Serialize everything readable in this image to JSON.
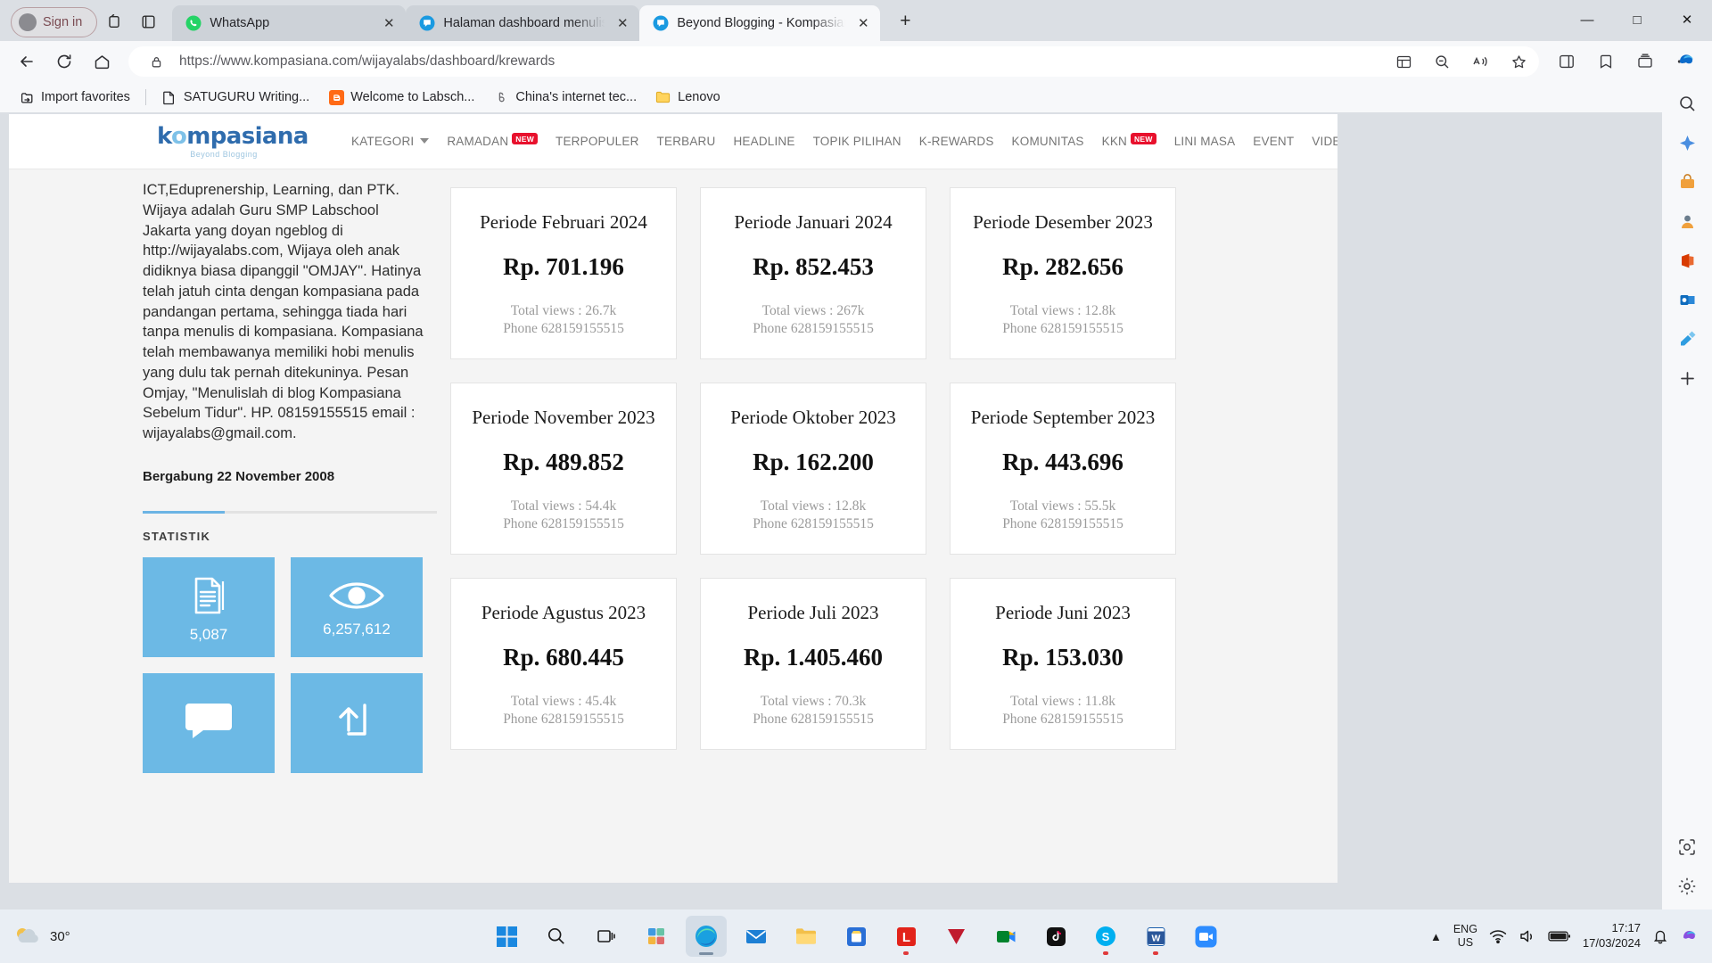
{
  "browser": {
    "signin_label": "Sign in",
    "tabs": [
      {
        "title": "WhatsApp",
        "favicon": "whatsapp-icon",
        "active": false
      },
      {
        "title": "Halaman dashboard menulis - Ko",
        "favicon": "kompasiana-icon",
        "active": false
      },
      {
        "title": "Beyond Blogging - Kompasiana.c",
        "favicon": "kompasiana-icon",
        "active": true
      }
    ],
    "new_tab_label": "+",
    "window_controls": {
      "minimize": "—",
      "maximize": "☐",
      "close": "✕"
    },
    "url": "https://www.kompasiana.com/wijayalabs/dashboard/krewards",
    "nav_icons": [
      "back-icon",
      "refresh-icon",
      "home-icon"
    ],
    "omnibox_icons": [
      "lock-icon",
      "split-screen-icon",
      "zoom-out-icon",
      "read-aloud-icon",
      "favorite-star-icon"
    ],
    "toolbar_icons": [
      "split-screen-icon",
      "favorites-icon",
      "collections-icon",
      "more-settings-icon"
    ],
    "bookmarks": [
      {
        "label": "Import favorites",
        "icon": "import-favorites-icon"
      },
      {
        "label": "SATUGURU Writing...",
        "icon": "page-icon"
      },
      {
        "label": "Welcome to Labsch...",
        "icon": "blogger-icon"
      },
      {
        "label": "China's internet tec...",
        "icon": "bookmark-b-icon"
      },
      {
        "label": "Lenovo",
        "icon": "folder-icon"
      }
    ]
  },
  "site": {
    "logo_text": "kompasiana",
    "logo_tagline": "Beyond Blogging",
    "nav": [
      {
        "label": "KATEGORI",
        "caret": true
      },
      {
        "label": "RAMADAN",
        "badge": "NEW"
      },
      {
        "label": "TERPOPULER"
      },
      {
        "label": "TERBARU"
      },
      {
        "label": "HEADLINE"
      },
      {
        "label": "TOPIK PILIHAN"
      },
      {
        "label": "K-REWARDS"
      },
      {
        "label": "KOMUNITAS"
      },
      {
        "label": "KKN",
        "badge": "NEW"
      },
      {
        "label": "LINI MASA"
      },
      {
        "label": "EVENT"
      },
      {
        "label": "VIDEO"
      }
    ]
  },
  "profile": {
    "bio": "ICT,Eduprenership, Learning, dan PTK. Wijaya adalah Guru SMP Labschool Jakarta yang doyan ngeblog di http://wijayalabs.com, Wijaya oleh anak didiknya biasa dipanggil \"OMJAY\". Hatinya telah jatuh cinta dengan kompasiana pada pandangan pertama, sehingga tiada hari tanpa menulis di kompasiana. Kompasiana telah membawanya memiliki hobi menulis yang dulu tak pernah ditekuninya. Pesan Omjay, \"Menulislah di blog Kompasiana Sebelum Tidur\". HP. 08159155515 email : wijayalabs@gmail.com.",
    "joined": "Bergabung 22 November 2008",
    "statistik_label": "STATISTIK",
    "stats": [
      {
        "icon": "article-icon",
        "value": "5,087"
      },
      {
        "icon": "eye-icon",
        "value": "6,257,612"
      },
      {
        "icon": "comment-icon",
        "value": ""
      },
      {
        "icon": "share-icon",
        "value": ""
      }
    ]
  },
  "krewards": {
    "cards": [
      {
        "period": "Periode Februari 2024",
        "amount": "Rp. 701.196",
        "views": "Total views : 26.7k",
        "phone": "Phone 628159155515"
      },
      {
        "period": "Periode Januari 2024",
        "amount": "Rp. 852.453",
        "views": "Total views : 267k",
        "phone": "Phone 628159155515"
      },
      {
        "period": "Periode Desember 2023",
        "amount": "Rp. 282.656",
        "views": "Total views : 12.8k",
        "phone": "Phone 628159155515"
      },
      {
        "period": "Periode November 2023",
        "amount": "Rp. 489.852",
        "views": "Total views : 54.4k",
        "phone": "Phone 628159155515"
      },
      {
        "period": "Periode Oktober 2023",
        "amount": "Rp. 162.200",
        "views": "Total views : 12.8k",
        "phone": "Phone 628159155515"
      },
      {
        "period": "Periode September 2023",
        "amount": "Rp. 443.696",
        "views": "Total views : 55.5k",
        "phone": "Phone 628159155515"
      },
      {
        "period": "Periode Agustus 2023",
        "amount": "Rp. 680.445",
        "views": "Total views : 45.4k",
        "phone": "Phone 628159155515"
      },
      {
        "period": "Periode Juli 2023",
        "amount": "Rp. 1.405.460",
        "views": "Total views : 70.3k",
        "phone": "Phone 628159155515"
      },
      {
        "period": "Periode Juni 2023",
        "amount": "Rp. 153.030",
        "views": "Total views : 11.8k",
        "phone": "Phone 628159155515"
      }
    ]
  },
  "taskbar": {
    "weather_temp": "30°",
    "apps": [
      "start-icon",
      "search-icon",
      "task-view-icon",
      "widgets-icon",
      "edge-icon",
      "mail-icon",
      "file-explorer-icon",
      "store-icon",
      "lenovo-icon",
      "mcafee-icon",
      "google-meet-icon",
      "tiktok-icon",
      "skype-icon",
      "word-icon",
      "zoom-icon"
    ],
    "language_line1": "ENG",
    "language_line2": "US",
    "time": "17:17",
    "date": "17/03/2024"
  },
  "colors": {
    "accent_blue": "#6cb9e5",
    "logo_blue": "#2f6cad",
    "badge_red": "#e8112d"
  }
}
